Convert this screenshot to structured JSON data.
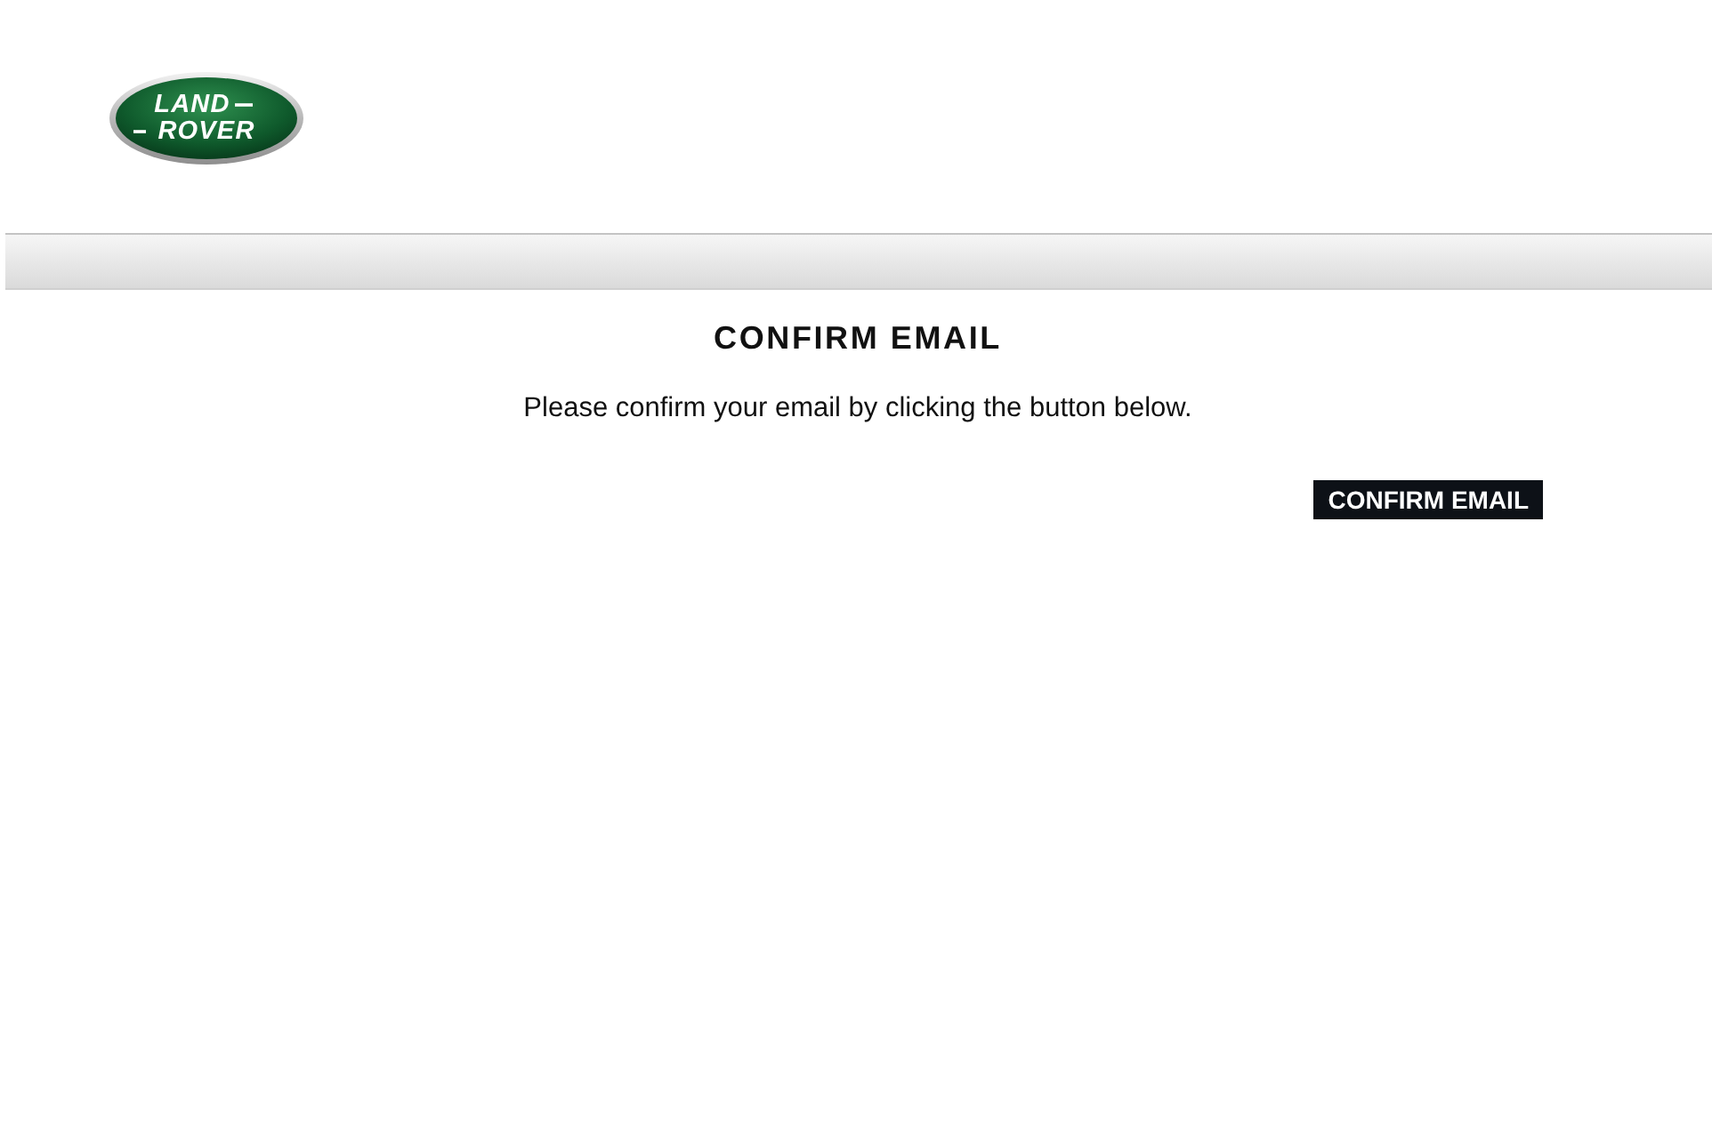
{
  "logo": {
    "line_1": "LAND",
    "line_2": "ROVER"
  },
  "title": "CONFIRM EMAIL",
  "message": "Please confirm your email by clicking the button below.",
  "confirm_button": {
    "label": "CONFIRM EMAIL"
  }
}
